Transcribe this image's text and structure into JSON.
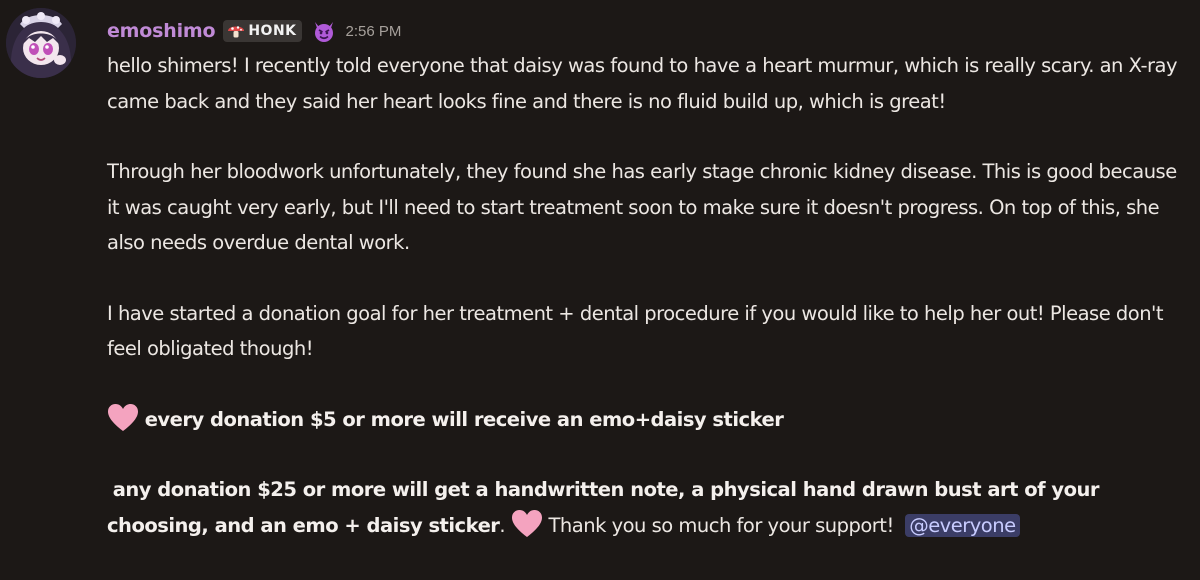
{
  "message": {
    "username": "emoshimo",
    "tag_label": "HONK",
    "timestamp": "2:56 PM",
    "para1": "hello shimers! I recently told everyone that daisy was found to have a heart murmur, which is really scary. an X-ray came back and they said her heart looks fine and there is no fluid build up, which is great!",
    "para2": "Through her bloodwork unfortunately, they found she has early stage chronic kidney disease. This is good because it was caught very early, but I'll need to start treatment soon to make sure it doesn't progress. On top of this, she also needs overdue dental work.",
    "para3": "I have started a donation goal for her treatment + dental procedure if you would like to help her out! Please don't feel obligated though!",
    "tier1": "every donation $5 or more will receive an emo+daisy sticker",
    "tier2_bold": "any donation $25 or more will get a handwritten note, a physical hand drawn bust art of your choosing, and an emo + daisy sticker",
    "tier2_period": ".",
    "thanks": "Thank you so much for your support!",
    "mention": "@everyone"
  },
  "icons": {
    "avatar": "avatar-image",
    "tag_icon": "mushroom-icon",
    "badge": "devil-icon",
    "heart": "pink-heart-icon"
  },
  "colors": {
    "background": "#1c1816",
    "username": "#c08ad6",
    "text": "#ece7e3",
    "timestamp": "#a6a09b",
    "mention_bg": "#3b3d66",
    "mention_fg": "#c8ccff",
    "heart": "#f4a3bf"
  }
}
